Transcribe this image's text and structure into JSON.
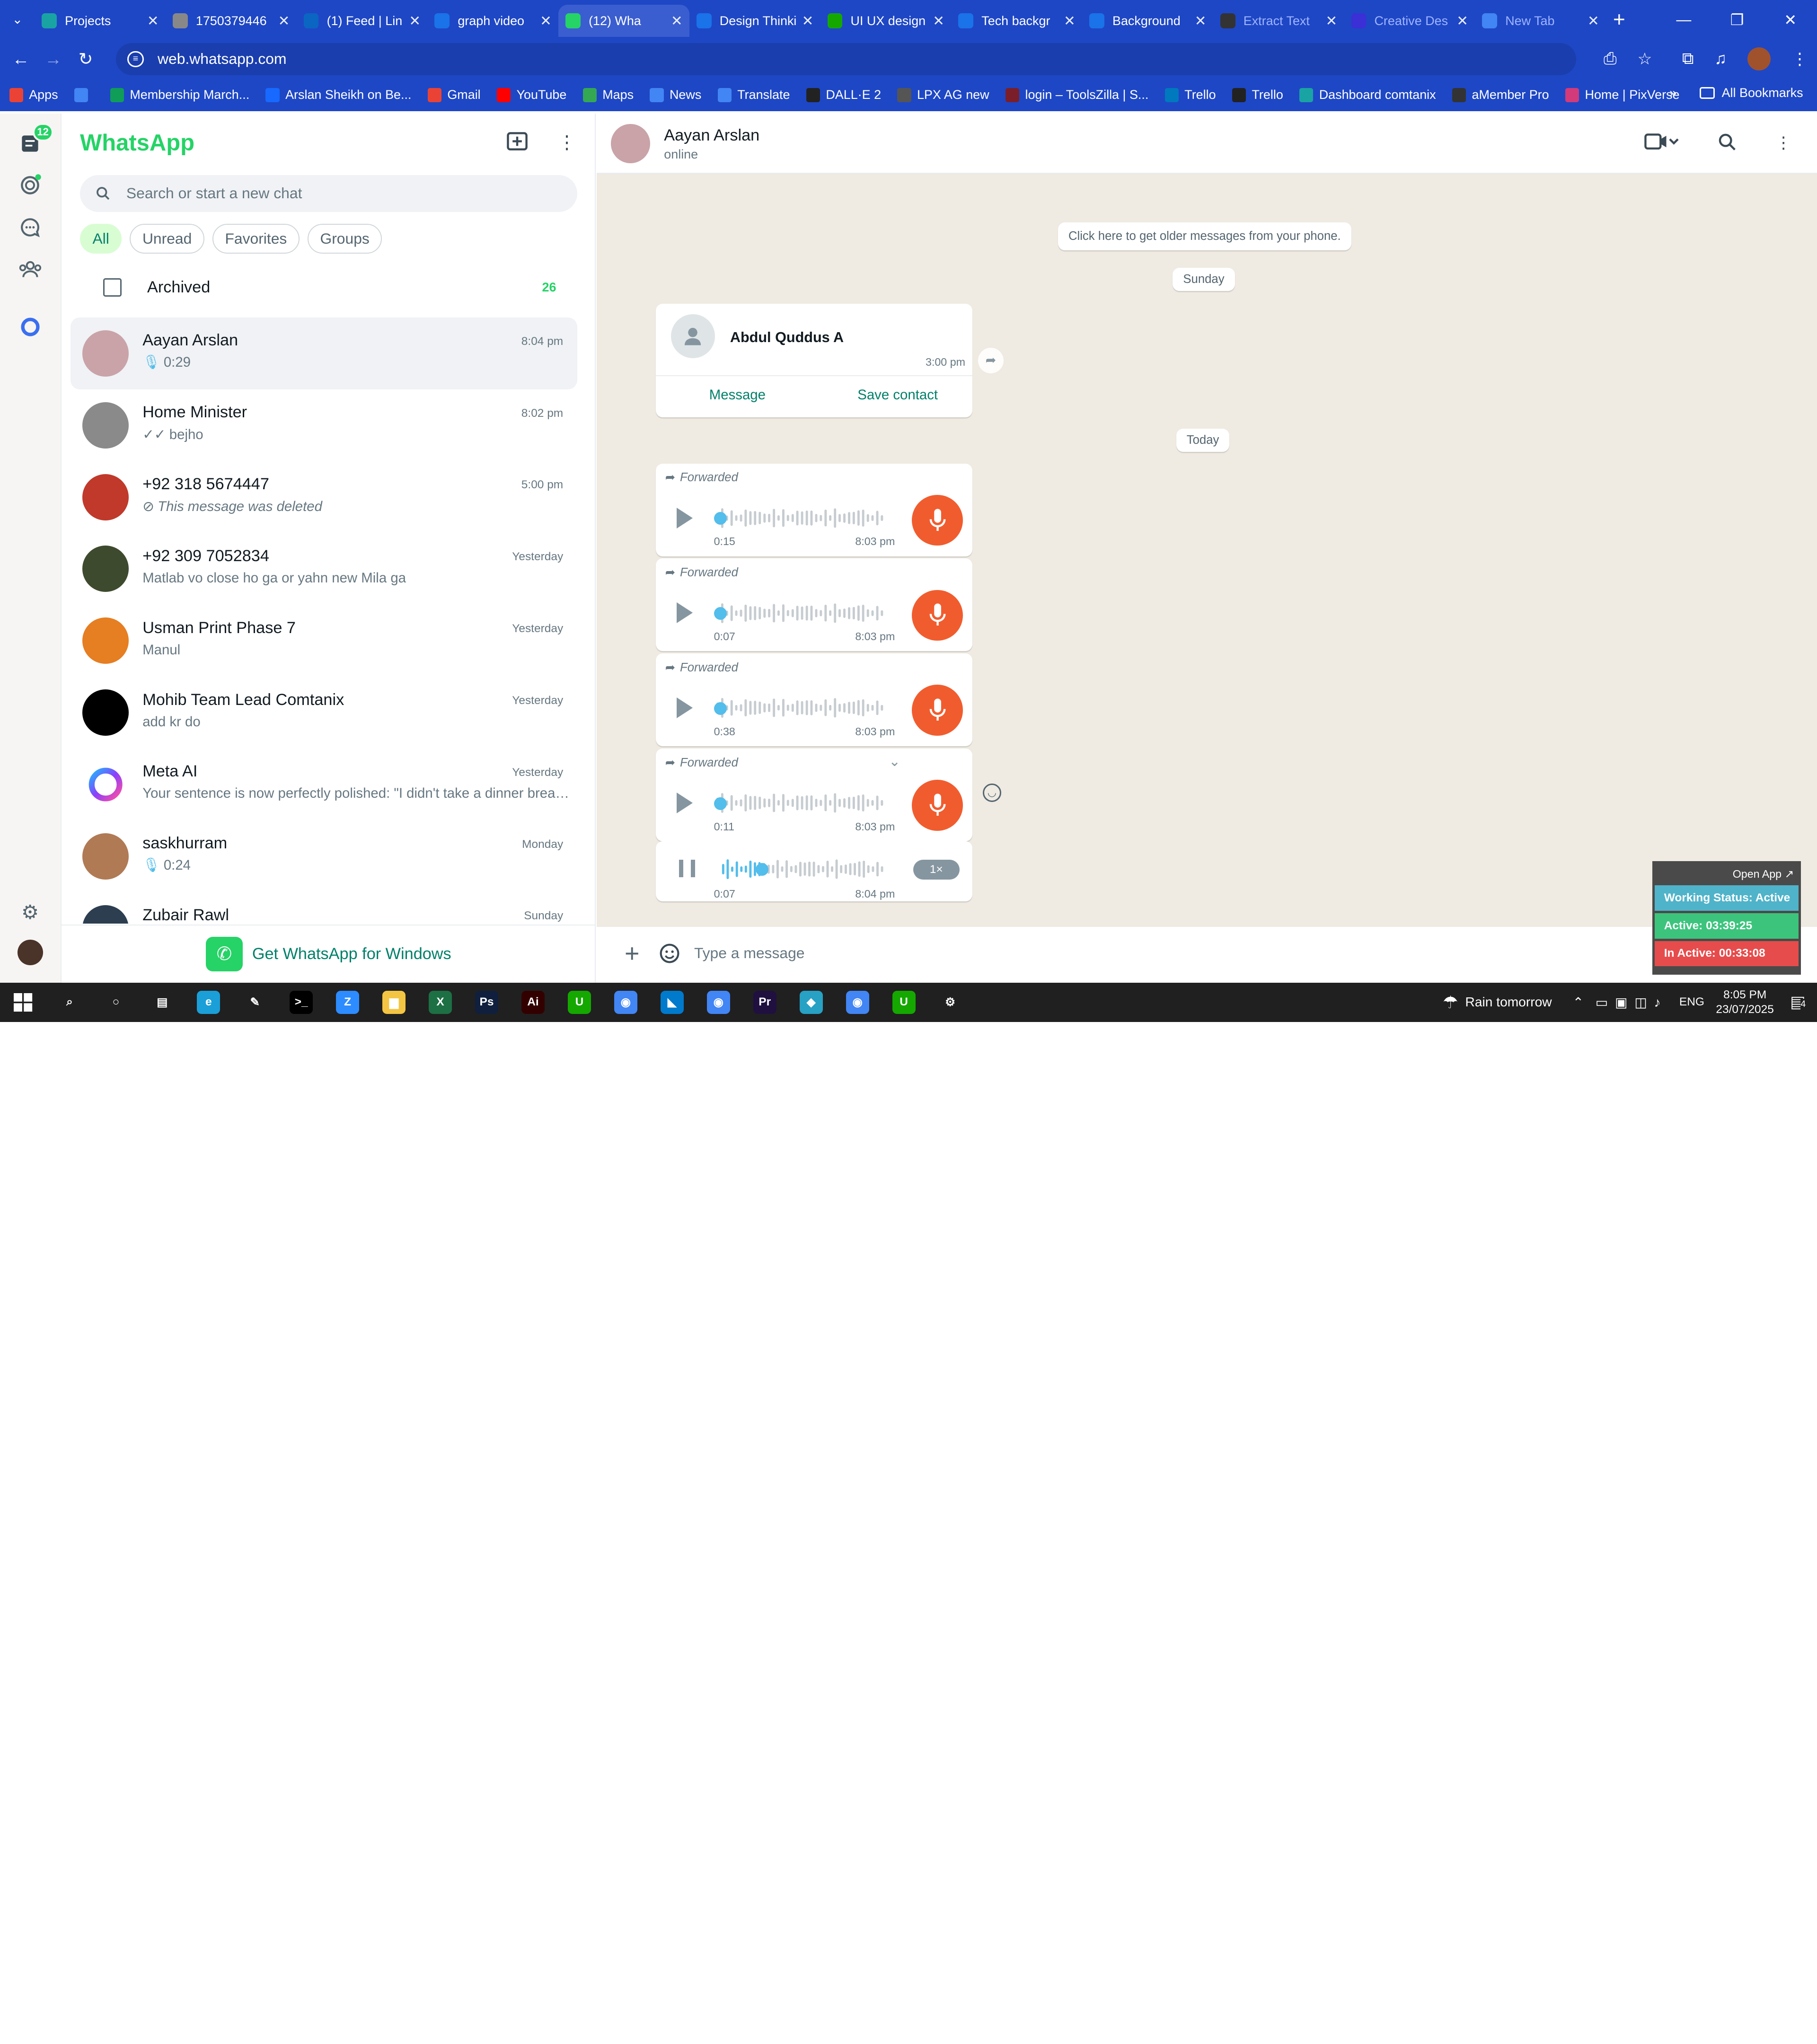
{
  "browser": {
    "tabs": [
      {
        "title": "Projects",
        "icon": "projects-icon",
        "color": "#1aa3a3"
      },
      {
        "title": "1750379446",
        "icon": "globe-icon",
        "color": "#888888"
      },
      {
        "title": "(1) Feed | Lin",
        "icon": "linkedin-icon",
        "color": "#0a66c2"
      },
      {
        "title": "graph video",
        "icon": "docs-icon",
        "color": "#1a73e8"
      },
      {
        "title": "(12) Wha",
        "icon": "whatsapp-icon",
        "color": "#25d366"
      },
      {
        "title": "Design Thinki",
        "icon": "docs-icon",
        "color": "#1a73e8"
      },
      {
        "title": "UI UX design",
        "icon": "upwork-icon",
        "color": "#14a800"
      },
      {
        "title": "Tech backgr",
        "icon": "docs-icon",
        "color": "#1a73e8"
      },
      {
        "title": "Background",
        "icon": "docs-icon",
        "color": "#1a73e8"
      },
      {
        "title": "Extract Text",
        "icon": "openai-icon",
        "color": "#333333"
      },
      {
        "title": "Creative Des",
        "icon": "creative-icon",
        "color": "#3b2fd6"
      },
      {
        "title": "New Tab",
        "icon": "chrome-icon",
        "color": "#4285f4"
      }
    ],
    "url": "web.whatsapp.com",
    "bookmarks": [
      {
        "label": "Apps",
        "color": "#ea4335"
      },
      {
        "label": "",
        "color": "#4285f4"
      },
      {
        "label": "Membership March...",
        "color": "#0f9d58"
      },
      {
        "label": "Arslan Sheikh on Be...",
        "color": "#1769ff"
      },
      {
        "label": "Gmail",
        "color": "#ea4335"
      },
      {
        "label": "YouTube",
        "color": "#ff0000"
      },
      {
        "label": "Maps",
        "color": "#34a853"
      },
      {
        "label": "News",
        "color": "#4285f4"
      },
      {
        "label": "Translate",
        "color": "#4285f4"
      },
      {
        "label": "DALL·E 2",
        "color": "#222222"
      },
      {
        "label": "LPX AG new",
        "color": "#555555"
      },
      {
        "label": "login – ToolsZilla | S...",
        "color": "#7a1f2a"
      },
      {
        "label": "Trello",
        "color": "#0079bf"
      },
      {
        "label": "Trello",
        "color": "#222222"
      },
      {
        "label": "Dashboard comtanix",
        "color": "#1aa3a3"
      },
      {
        "label": "aMember Pro",
        "color": "#333333"
      },
      {
        "label": "Home | PixVerse",
        "color": "#d23a7a"
      }
    ],
    "all_bookmarks": "All Bookmarks"
  },
  "rail": {
    "chats_badge": "12"
  },
  "sidebar": {
    "brand": "WhatsApp",
    "search_placeholder": "Search or start a new chat",
    "filters": [
      "All",
      "Unread",
      "Favorites",
      "Groups"
    ],
    "archived_label": "Archived",
    "archived_count": "26",
    "chats": [
      {
        "name": "Aayan Arslan",
        "time": "8:04 pm",
        "preview": "0:29",
        "kind": "voice",
        "avatar": "#c9a3a8",
        "selected": true
      },
      {
        "name": "Home Minister",
        "time": "8:02 pm",
        "preview": "bejho",
        "kind": "ticks",
        "avatar": "#8a8a8a"
      },
      {
        "name": "+92 318 5674447",
        "time": "5:00 pm",
        "preview": "This message was deleted",
        "kind": "deleted",
        "avatar": "#c0392b"
      },
      {
        "name": "+92 309 7052834",
        "time": "Yesterday",
        "preview": "Matlab vo close ho ga or yahn new Mila ga",
        "kind": "text",
        "avatar": "#3d4a2e"
      },
      {
        "name": "Usman Print Phase 7",
        "time": "Yesterday",
        "preview": "Manul",
        "kind": "text",
        "avatar": "#e67e22"
      },
      {
        "name": "Mohib Team Lead Comtanix",
        "time": "Yesterday",
        "preview": "add kr do",
        "kind": "text",
        "avatar": "#000000"
      },
      {
        "name": "Meta AI",
        "time": "Yesterday",
        "preview": "Your sentence is now perfectly polished: \"I didn't take a dinner break,...",
        "kind": "text",
        "avatar": "meta"
      },
      {
        "name": "saskhurram",
        "time": "Monday",
        "preview": "0:24",
        "kind": "voice",
        "avatar": "#b07a55"
      },
      {
        "name": "Zubair Rawl",
        "time": "Sunday",
        "preview": "",
        "kind": "text",
        "avatar": "#2c3e50"
      }
    ],
    "get_windows": "Get WhatsApp for Windows"
  },
  "conversation": {
    "name": "Aayan Arslan",
    "status": "online",
    "older_msgs": "Click here to get older messages from your phone.",
    "day1": "Sunday",
    "day2": "Today",
    "contact_card": {
      "name": "Abdul Quddus A",
      "time": "3:00 pm",
      "action1": "Message",
      "action2": "Save contact"
    },
    "voice_notes": [
      {
        "label": "Forwarded",
        "duration": "0:15",
        "time": "8:03 pm"
      },
      {
        "label": "Forwarded",
        "duration": "0:07",
        "time": "8:03 pm"
      },
      {
        "label": "Forwarded",
        "duration": "0:38",
        "time": "8:03 pm"
      },
      {
        "label": "Forwarded",
        "duration": "0:11",
        "time": "8:03 pm"
      }
    ],
    "playing": {
      "duration": "0:07",
      "time": "8:04 pm",
      "speed": "1×"
    },
    "composer_placeholder": "Type a message"
  },
  "widget": {
    "open_app": "Open App ↗",
    "status": "Working Status: Active",
    "active": "Active: 03:39:25",
    "inactive": "In Active: 00:33:08",
    "colors": {
      "status": "#4fb3c9",
      "active": "#3cc47c",
      "inactive": "#e74c4c"
    }
  },
  "taskbar": {
    "weather": "Rain tomorrow",
    "lang": "ENG",
    "time": "8:05 PM",
    "date": "23/07/2025",
    "notif": "4",
    "apps": [
      {
        "name": "search-app",
        "color": "#202020",
        "glyph": "⌕"
      },
      {
        "name": "cortana-app",
        "color": "#202020",
        "glyph": "○"
      },
      {
        "name": "taskview-app",
        "color": "#202020",
        "glyph": "▤"
      },
      {
        "name": "edge-app",
        "color": "#1a9fd8",
        "glyph": "e"
      },
      {
        "name": "pen-app",
        "color": "#202020",
        "glyph": "✎"
      },
      {
        "name": "terminal-app",
        "color": "#000000",
        "glyph": ">_"
      },
      {
        "name": "zoom-app",
        "color": "#2d8cff",
        "glyph": "Z"
      },
      {
        "name": "explorer-app",
        "color": "#f4c542",
        "glyph": "▆"
      },
      {
        "name": "excel-app",
        "color": "#1d7044",
        "glyph": "X"
      },
      {
        "name": "photoshop-app",
        "color": "#0f1f3d",
        "glyph": "Ps"
      },
      {
        "name": "illustrator-app",
        "color": "#330000",
        "glyph": "Ai"
      },
      {
        "name": "upwork-app",
        "color": "#14a800",
        "glyph": "U"
      },
      {
        "name": "chrome-app",
        "color": "#4285f4",
        "glyph": "◉"
      },
      {
        "name": "vscode-app",
        "color": "#007acc",
        "glyph": "◣"
      },
      {
        "name": "chrome2-app",
        "color": "#4285f4",
        "glyph": "◉"
      },
      {
        "name": "premiere-app",
        "color": "#1f1040",
        "glyph": "Pr"
      },
      {
        "name": "app-diamond",
        "color": "#27a1c4",
        "glyph": "◆"
      },
      {
        "name": "chrome3-app",
        "color": "#4285f4",
        "glyph": "◉"
      },
      {
        "name": "upwork2-app",
        "color": "#14a800",
        "glyph": "U"
      },
      {
        "name": "settings-app",
        "color": "#202020",
        "glyph": "⚙"
      }
    ]
  }
}
